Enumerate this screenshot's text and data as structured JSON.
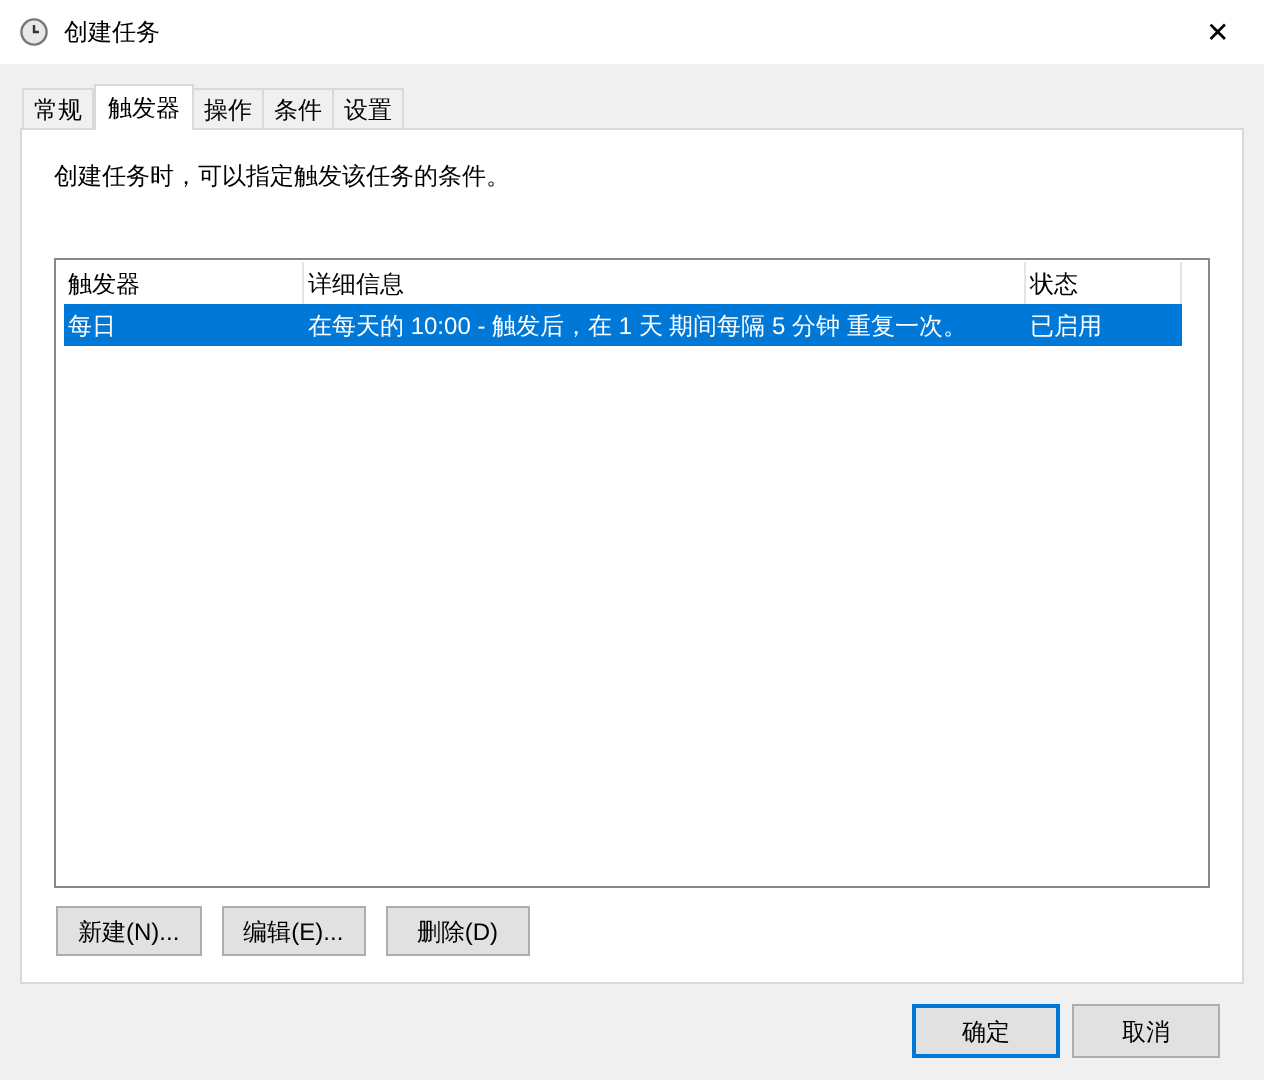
{
  "window": {
    "title": "创建任务",
    "close": "✕"
  },
  "tabs": [
    {
      "label": "常规",
      "selected": false
    },
    {
      "label": "触发器",
      "selected": true
    },
    {
      "label": "操作",
      "selected": false
    },
    {
      "label": "条件",
      "selected": false
    },
    {
      "label": "设置",
      "selected": false
    }
  ],
  "description": "创建任务时，可以指定触发该任务的条件。",
  "table": {
    "columns": [
      "触发器",
      "详细信息",
      "状态"
    ],
    "rows": [
      {
        "cells": [
          "每日",
          "在每天的 10:00 - 触发后，在 1 天 期间每隔 5 分钟 重复一次。",
          "已启用"
        ],
        "selected": true
      }
    ]
  },
  "list_buttons": [
    "新建(N)...",
    "编辑(E)...",
    "删除(D)"
  ],
  "dialog_buttons": [
    {
      "label": "确定",
      "default": true
    },
    {
      "label": "取消",
      "default": false
    }
  ]
}
